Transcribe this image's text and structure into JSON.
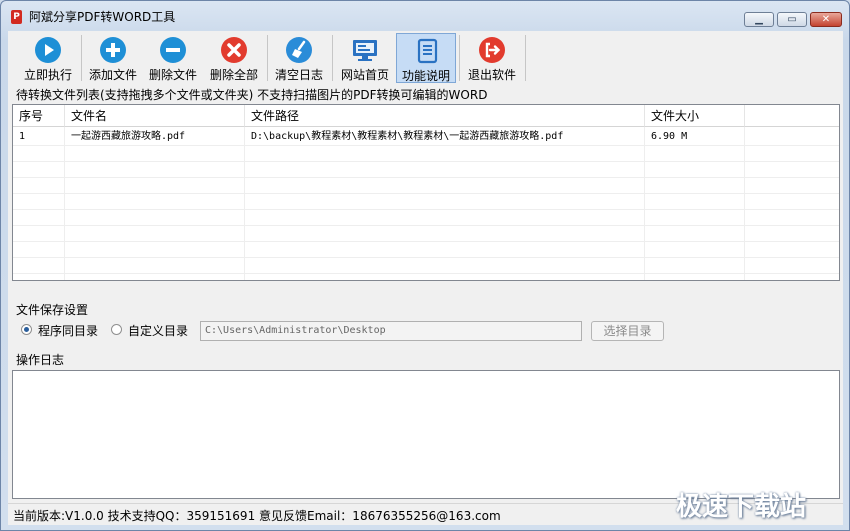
{
  "window": {
    "title": "阿斌分享PDF转WORD工具"
  },
  "toolbar": {
    "buttons": [
      {
        "label": "立即执行",
        "icon": "play-icon",
        "color": "#1e8fd6"
      },
      {
        "label": "添加文件",
        "icon": "plus-icon",
        "color": "#1e8fd6"
      },
      {
        "label": "删除文件",
        "icon": "minus-icon",
        "color": "#1e8fd6"
      },
      {
        "label": "删除全部",
        "icon": "close-icon",
        "color": "#e23b2e"
      },
      {
        "label": "清空日志",
        "icon": "broom-icon",
        "color": "#2a8cd8"
      },
      {
        "label": "网站首页",
        "icon": "monitor-icon",
        "color": "#2a72c2"
      },
      {
        "label": "功能说明",
        "icon": "document-icon",
        "color": "#2a72c2"
      },
      {
        "label": "退出软件",
        "icon": "exit-icon",
        "color": "#e23b2e"
      }
    ]
  },
  "file_list": {
    "hint": "待转换文件列表(支持拖拽多个文件或文件夹) 不支持扫描图片的PDF转换可编辑的WORD",
    "columns": [
      "序号",
      "文件名",
      "文件路径",
      "文件大小"
    ],
    "rows": [
      [
        "1",
        "一起游西藏旅游攻略.pdf",
        "D:\\backup\\教程素材\\教程素材\\教程素材\\一起游西藏旅游攻略.pdf",
        "6.90 M"
      ]
    ]
  },
  "save_settings": {
    "label": "文件保存设置",
    "option_same": "程序同目录",
    "option_custom": "自定义目录",
    "selected": "程序同目录",
    "path": "C:\\Users\\Administrator\\Desktop",
    "choose_button": "选择目录"
  },
  "log": {
    "label": "操作日志"
  },
  "status": {
    "text": "当前版本:V1.0.0  技术支持QQ：359151691  意见反馈Email：18676355256@163.com"
  },
  "watermark": "极速下载站"
}
